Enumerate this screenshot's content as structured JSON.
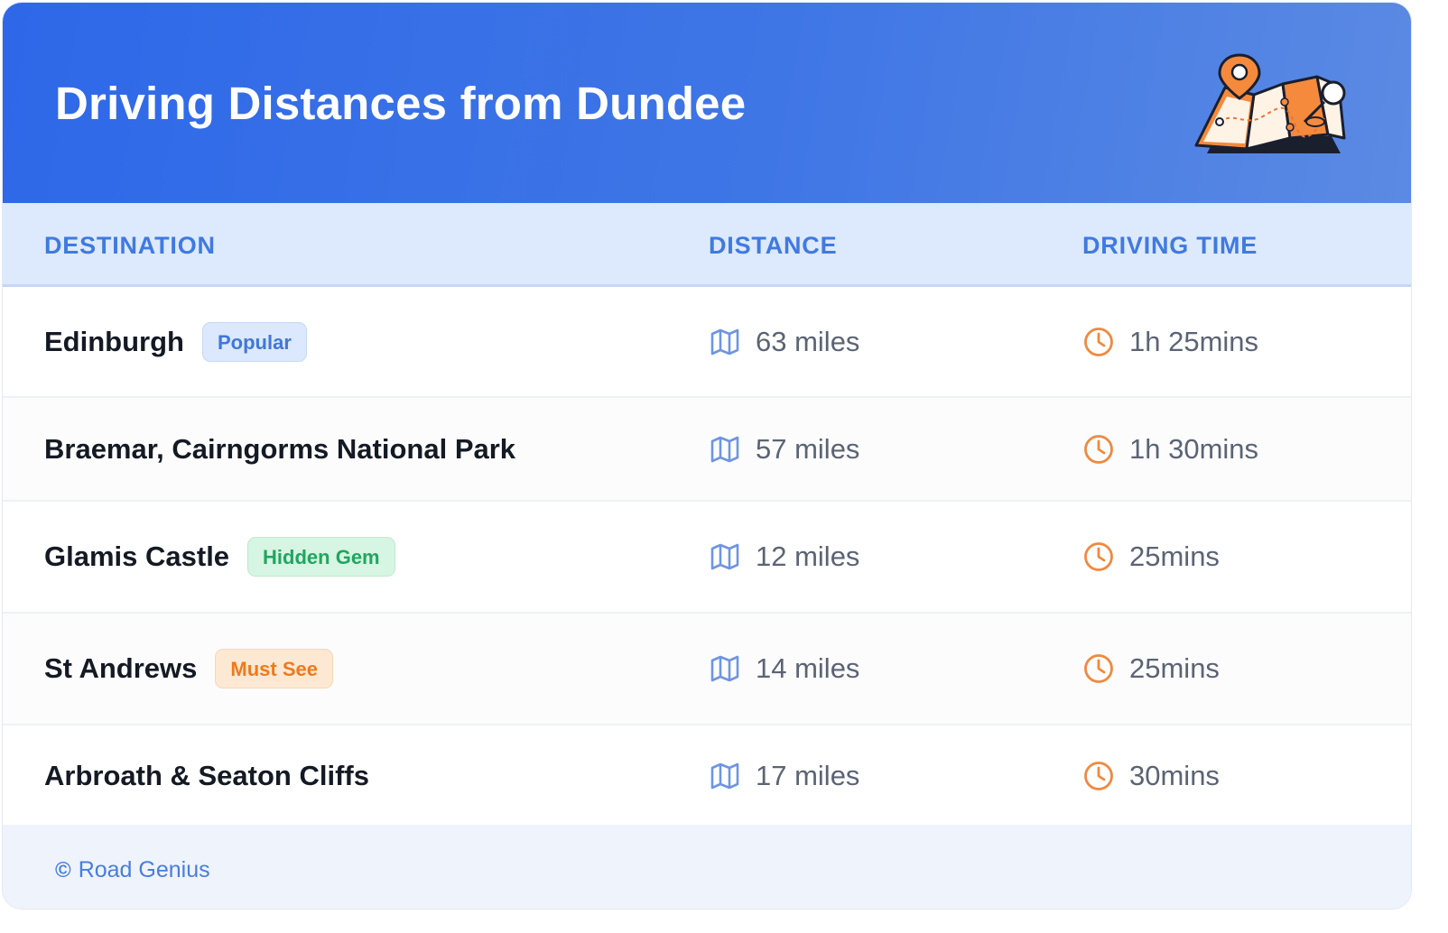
{
  "header": {
    "title": "Driving Distances from Dundee",
    "illustration_icon": "folded-map-with-pin-icon"
  },
  "table": {
    "columns": [
      "DESTINATION",
      "DISTANCE",
      "DRIVING TIME"
    ],
    "rows": [
      {
        "destination": "Edinburgh",
        "badge": "Popular",
        "badge_style": "blue",
        "distance": "63 miles",
        "time": "1h 25mins"
      },
      {
        "destination": "Braemar, Cairngorms National Park",
        "badge": "",
        "badge_style": "",
        "distance": "57 miles",
        "time": "1h 30mins"
      },
      {
        "destination": "Glamis Castle",
        "badge": "Hidden Gem",
        "badge_style": "green",
        "distance": "12 miles",
        "time": "25mins"
      },
      {
        "destination": "St Andrews",
        "badge": "Must See",
        "badge_style": "orange",
        "distance": "14 miles",
        "time": "25mins"
      },
      {
        "destination": "Arbroath & Seaton Cliffs",
        "badge": "",
        "badge_style": "",
        "distance": "17 miles",
        "time": "30mins"
      }
    ],
    "distance_icon": "map-icon",
    "time_icon": "clock-icon"
  },
  "footer": {
    "copyright_symbol": "©",
    "credit": "Road Genius"
  },
  "colors": {
    "header_blue": "#2e68e8",
    "header_text": "#ffffff",
    "column_header_text": "#3f7ae0",
    "icon_blue": "#6f95e0",
    "icon_orange": "#ef8a3e",
    "badge_blue": "#4077d9",
    "badge_green": "#22a55f",
    "badge_orange": "#ee7a1d"
  }
}
